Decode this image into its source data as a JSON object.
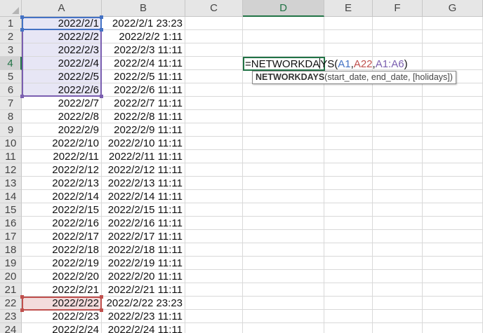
{
  "columns": [
    "A",
    "B",
    "C",
    "D",
    "E",
    "F",
    "G"
  ],
  "active_column": "D",
  "active_row": "4",
  "rows": [
    {
      "num": "1",
      "a": "2022/2/1",
      "b": "2022/2/1 23:23"
    },
    {
      "num": "2",
      "a": "2022/2/2",
      "b": "2022/2/2 1:11"
    },
    {
      "num": "3",
      "a": "2022/2/3",
      "b": "2022/2/3 11:11"
    },
    {
      "num": "4",
      "a": "2022/2/4",
      "b": "2022/2/4 11:11"
    },
    {
      "num": "5",
      "a": "2022/2/5",
      "b": "2022/2/5 11:11"
    },
    {
      "num": "6",
      "a": "2022/2/6",
      "b": "2022/2/6 11:11"
    },
    {
      "num": "7",
      "a": "2022/2/7",
      "b": "2022/2/7 11:11"
    },
    {
      "num": "8",
      "a": "2022/2/8",
      "b": "2022/2/8 11:11"
    },
    {
      "num": "9",
      "a": "2022/2/9",
      "b": "2022/2/9 11:11"
    },
    {
      "num": "10",
      "a": "2022/2/10",
      "b": "2022/2/10 11:11"
    },
    {
      "num": "11",
      "a": "2022/2/11",
      "b": "2022/2/11 11:11"
    },
    {
      "num": "12",
      "a": "2022/2/12",
      "b": "2022/2/12 11:11"
    },
    {
      "num": "13",
      "a": "2022/2/13",
      "b": "2022/2/13 11:11"
    },
    {
      "num": "14",
      "a": "2022/2/14",
      "b": "2022/2/14 11:11"
    },
    {
      "num": "15",
      "a": "2022/2/15",
      "b": "2022/2/15 11:11"
    },
    {
      "num": "16",
      "a": "2022/2/16",
      "b": "2022/2/16 11:11"
    },
    {
      "num": "17",
      "a": "2022/2/17",
      "b": "2022/2/17 11:11"
    },
    {
      "num": "18",
      "a": "2022/2/18",
      "b": "2022/2/18 11:11"
    },
    {
      "num": "19",
      "a": "2022/2/19",
      "b": "2022/2/19 11:11"
    },
    {
      "num": "20",
      "a": "2022/2/20",
      "b": "2022/2/20 11:11"
    },
    {
      "num": "21",
      "a": "2022/2/21",
      "b": "2022/2/21 11:11"
    },
    {
      "num": "22",
      "a": "2022/2/22",
      "b": "2022/2/22 23:23"
    },
    {
      "num": "23",
      "a": "2022/2/23",
      "b": "2022/2/23 11:11"
    },
    {
      "num": "24",
      "a": "2022/2/24",
      "b": "2022/2/24 11:11"
    }
  ],
  "formula": {
    "prefix": "=NETWORKDA",
    "after_caret": "YS(",
    "arg1": "A1",
    "sep1": ",",
    "arg2": "A22",
    "sep2": ",",
    "arg3": "A1:A6",
    "close": ")"
  },
  "tooltip": {
    "function_name": "NETWORKDAYS",
    "params": "(start_date, end_date, [holidays])"
  },
  "colors": {
    "accent_green": "#217346",
    "ref_blue": "#4472c4",
    "ref_red": "#c0504d",
    "ref_purple": "#7b5fb0"
  }
}
